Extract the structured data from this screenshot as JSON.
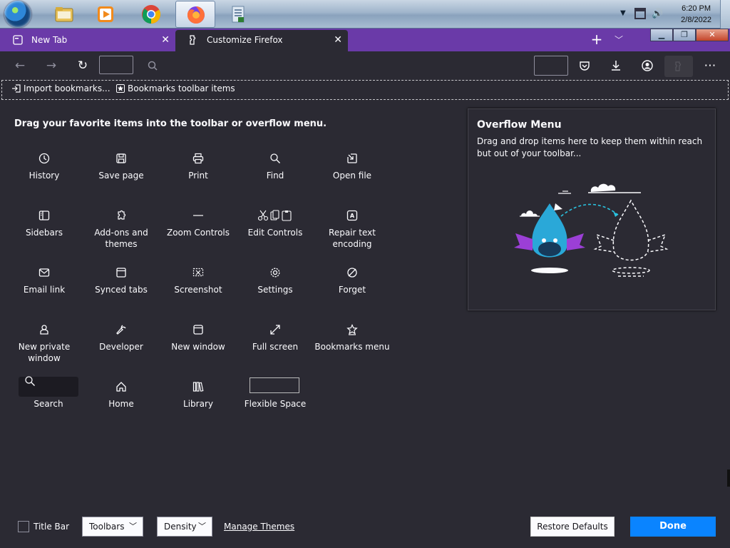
{
  "taskbar": {
    "apps": [
      {
        "name": "Windows Explorer",
        "icon": "folder-icon",
        "active": false
      },
      {
        "name": "Windows Media Player",
        "icon": "media-player-icon",
        "active": false
      },
      {
        "name": "Google Chrome",
        "icon": "chrome-icon",
        "active": false
      },
      {
        "name": "Firefox",
        "icon": "firefox-icon",
        "active": true
      },
      {
        "name": "Document",
        "icon": "document-icon",
        "active": false
      }
    ],
    "clock": {
      "time": "6:20 PM",
      "date": "2/8/2022"
    }
  },
  "tabs": [
    {
      "label": "New Tab",
      "selected": false
    },
    {
      "label": "Customize Firefox",
      "selected": true
    }
  ],
  "colors": {
    "tabstrip": "#6a3aa8",
    "background": "#2b2a33",
    "accent": "#0a84ff"
  },
  "bookmarks_bar": {
    "import_label": "Import bookmarks...",
    "toolbar_items_label": "Bookmarks toolbar items"
  },
  "palette": {
    "title": "Drag your favorite items into the toolbar or overflow menu.",
    "items": [
      {
        "label": "History",
        "icon": "history-icon"
      },
      {
        "label": "Save page",
        "icon": "save-icon"
      },
      {
        "label": "Print",
        "icon": "print-icon"
      },
      {
        "label": "Find",
        "icon": "find-icon"
      },
      {
        "label": "Open file",
        "icon": "open-file-icon"
      },
      {
        "label": "Sidebars",
        "icon": "sidebar-icon"
      },
      {
        "label": "Add-ons and themes",
        "icon": "addons-icon"
      },
      {
        "label": "Zoom Controls",
        "icon": "zoom-icon"
      },
      {
        "label": "Edit Controls",
        "icon": "edit-controls-icon"
      },
      {
        "label": "Repair text encoding",
        "icon": "text-encoding-icon"
      },
      {
        "label": "Email link",
        "icon": "email-icon"
      },
      {
        "label": "Synced tabs",
        "icon": "synced-tabs-icon"
      },
      {
        "label": "Screenshot",
        "icon": "screenshot-icon"
      },
      {
        "label": "Settings",
        "icon": "settings-icon"
      },
      {
        "label": "Forget",
        "icon": "forget-icon"
      },
      {
        "label": "New private window",
        "icon": "private-window-icon"
      },
      {
        "label": "Developer",
        "icon": "developer-icon"
      },
      {
        "label": "New window",
        "icon": "new-window-icon"
      },
      {
        "label": "Full screen",
        "icon": "fullscreen-icon"
      },
      {
        "label": "Bookmarks menu",
        "icon": "bookmarks-menu-icon"
      },
      {
        "label": "Search",
        "icon": "search-icon"
      },
      {
        "label": "Home",
        "icon": "home-icon"
      },
      {
        "label": "Library",
        "icon": "library-icon"
      },
      {
        "label": "Flexible Space",
        "icon": "flexible-space-icon"
      }
    ]
  },
  "overflow": {
    "title": "Overflow Menu",
    "description": "Drag and drop items here to keep them within reach but out of your toolbar..."
  },
  "footer": {
    "title_bar_label": "Title Bar",
    "title_bar_checked": false,
    "toolbars_label": "Toolbars",
    "density_label": "Density",
    "manage_themes_label": "Manage Themes",
    "restore_label": "Restore Defaults",
    "done_label": "Done"
  }
}
